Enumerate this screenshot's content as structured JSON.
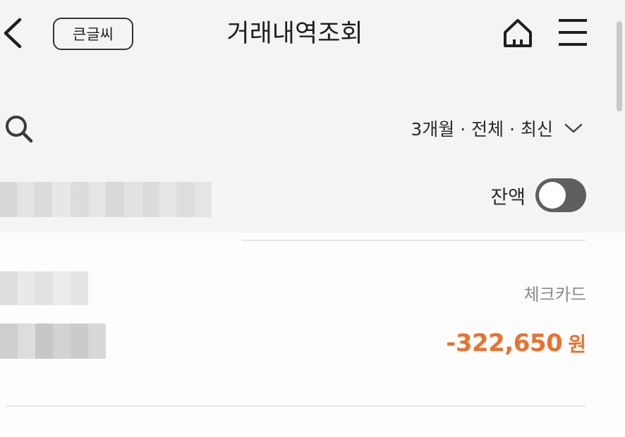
{
  "header": {
    "title": "거래내역조회",
    "big_text_label": "큰글씨",
    "back_icon": "chevron-left-icon",
    "home_icon": "home-icon",
    "menu_icon": "hamburger-menu-icon"
  },
  "filter": {
    "summary": "3개월 · 전체 · 최신",
    "search_icon": "search-icon",
    "dropdown_icon": "chevron-down-icon"
  },
  "balance": {
    "label": "잔액",
    "toggle_on": false
  },
  "transactions": [
    {
      "type": "체크카드",
      "amount": "-322,650",
      "unit": "원"
    }
  ],
  "colors": {
    "accent_amount": "#e8722e",
    "background": "#f4f4f4",
    "list_background": "#fdfdfd",
    "toggle_off": "#5f5f5f"
  }
}
